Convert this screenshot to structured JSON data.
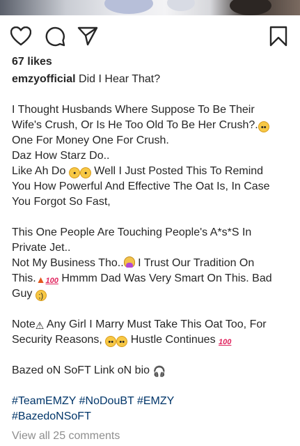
{
  "post": {
    "likes": "67 likes",
    "username": "emzyofficial",
    "caption_first": " Did I Hear That?",
    "caption_lines": [
      "I Thought Husbands Where Suppose To Be Their",
      "Wife's Crush, Or Is He Too Old To Be Her Crush?.",
      "One For Money One For Crush.",
      "Daz How Starz Do..",
      "Like Ah Do ",
      " Well I Just Posted This To Remind",
      "You How Powerful And Effective The Oat Is, In Case",
      "You Forgot So Fast,",
      "This One People Are Touching People's A*s*S In",
      "Private Jet..",
      "Not My Business Tho..",
      " I Trust Our Tradition On",
      "This.",
      " Hmmm Dad Was Very Smart On This. Bad",
      "Guy ",
      "Note",
      " Any Girl I Marry Must Take This Oat Too, For",
      "Security Reasons, ",
      " Hustle Continues ",
      "Bazed oN SoFT Link oN bio "
    ],
    "hashtags_line1": [
      "#TeamEMZY",
      "#NoDouBT",
      "#EMZY"
    ],
    "hashtags_line2": [
      "#BazedoNSoFT"
    ],
    "view_all_comments": "View all 25 comments"
  },
  "icons": {
    "like": "heart-icon",
    "comment": "comment-icon",
    "share": "send-icon",
    "save": "bookmark-icon"
  }
}
